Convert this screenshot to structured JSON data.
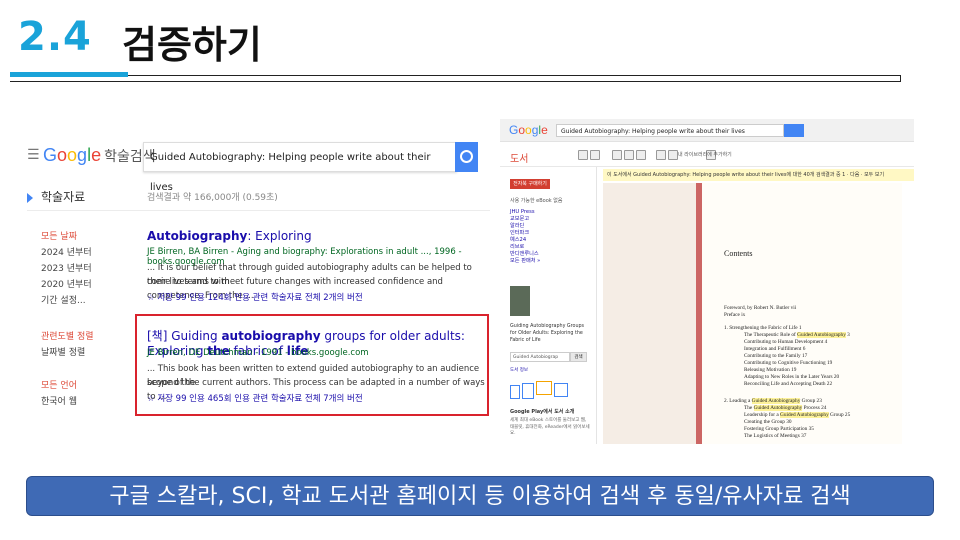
{
  "slide": {
    "section_number": "2.4",
    "section_title": "검증하기",
    "caption": "구글 스칼라, SCI, 학교 도서관 홈페이지 등 이용하여 검색 후 동일/유사자료 검색",
    "accent_color": "#1aa3d9",
    "caption_color": "#3f6ab5"
  },
  "scholar": {
    "menu_icon": "☰",
    "logo_word": "Google",
    "logo_suffix": "학술검색",
    "search_value": "Guided Autobiography: Helping people write about their lives",
    "category": "학술자료",
    "result_count": "검색결과 약 166,000개 (0.59초)",
    "sidebar": {
      "any_time": "모든 날짜",
      "since_2024": "2024 년부터",
      "since_2023": "2023 년부터",
      "since_2020": "2020 년부터",
      "custom_range": "기간 설정...",
      "sort_relevance": "관련도별 정렬",
      "sort_date": "날짜별 정렬",
      "any_language": "모든 언어",
      "korean_pages": "한국어 웹"
    },
    "results": [
      {
        "title_a": "Autobiography",
        "title_b": ": Exploring",
        "meta": "JE Birren, BA Birren - Aging and biography: Explorations in adult ..., 1996 - books.google.com",
        "snippet1": "... It is our belief that through guided autobiography adults can be helped to come to terms with",
        "snippet2": "their lives and to meet future changes with increased confidence and competence. From the ...",
        "links": "☆ 저장  99 인용  124회 인용  관련 학술자료  전체 2개의 버전"
      },
      {
        "prefix": "[책]",
        "title_a": " Guiding ",
        "title_b": "autobiography",
        "title_c": " groups for older adults: Exploring ",
        "title_d": "the",
        "title_e": " fabric of ",
        "title_f": "life",
        "meta": "JE Birren, DE Deutchman - 1991 - books.google.com",
        "snippet1": "... This book has been written to extend guided autobiography to an audience beyond the",
        "snippet2": "scope of the current authors. This process can be adapted in a number of ways to ...",
        "links": "☆ 저장  99 인용  465회 인용  관련 학술자료  전체 7개의 버전"
      }
    ]
  },
  "books": {
    "logo_word": "Google",
    "search_value": "Guided Autobiography: Helping people write about their lives",
    "section_label": "도서",
    "toolbar_text": "내 라이브러리에 추가하기",
    "banner": "이 도서에서 Guided Autobiography: Helping people write about their lives에 대한 40개 검색결과 중 1 · 다음 · 모두 보기",
    "buy_button": "전자북 구매하기",
    "available": "사용 가능한 eBook 없음",
    "stores": [
      "JHU Press",
      "교보문고",
      "알라딘",
      "인터파크",
      "예스24",
      "리브로",
      "반디앤루니스",
      "모든 판매처 »"
    ],
    "book_title": "Guiding Autobiography Groups for Older Adults: Exploring the Fabric of Life",
    "find_placeholder": "Guided Autobiograp",
    "find_button": "검색",
    "reviews_link": "도서 정보",
    "google_play": "Google Play에서 도서 소개",
    "google_play_text": "세계 최대 eBook 스토어를 둘러보고 웹, 태블릿, 휴대전화, eReader에서 읽어보세요.",
    "contents_heading": "Contents",
    "toc": [
      {
        "text": "Foreword, by Robert N. Butler    vii"
      },
      {
        "text": "Preface    ix"
      },
      {
        "text": "1. Strengthening the Fabric of Life    1"
      },
      {
        "text": "The Therapeutic Role of ",
        "hl": "Guided Autobiography",
        "tail": "    3"
      },
      {
        "text": "Contributing to Human Development    4"
      },
      {
        "text": "Integration and Fulfillment    6"
      },
      {
        "text": "Contributing to the Family    17"
      },
      {
        "text": "Contributing to Cognitive Functioning    19"
      },
      {
        "text": "Releasing Motivation    19"
      },
      {
        "text": "Adapting to New Roles in the Later Years    20"
      },
      {
        "text": "Reconciling Life and Accepting Death    22"
      },
      {
        "text": "2. Leading a ",
        "hl": "Guided Autobiography",
        "tail": " Group    23"
      },
      {
        "text": "The ",
        "hl": "Guided Autobiography",
        "tail": " Process    24"
      },
      {
        "text": "Leadership for a ",
        "hl": "Guided Autobiography",
        "tail": " Group    25"
      },
      {
        "text": "Creating the Group    30"
      },
      {
        "text": "Fostering Group Participation    35"
      },
      {
        "text": "The Logistics of Meetings    37"
      }
    ]
  }
}
